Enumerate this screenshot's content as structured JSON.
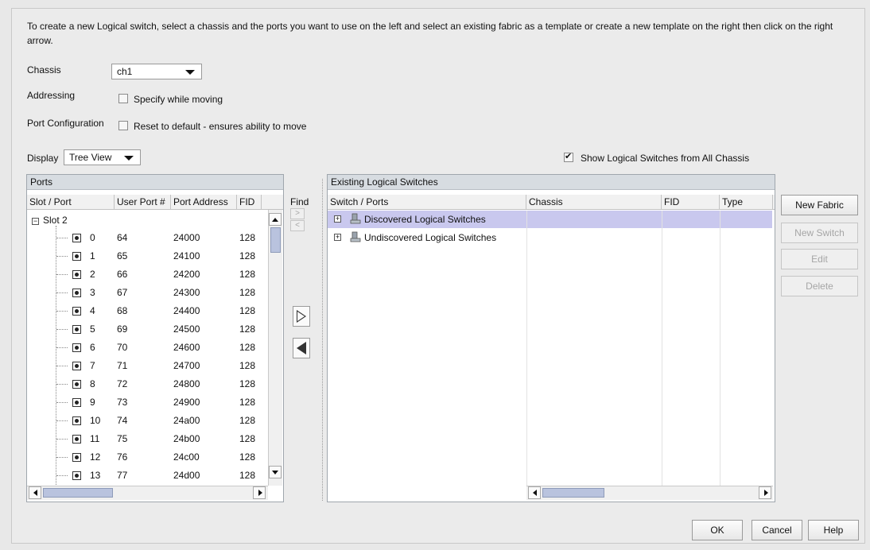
{
  "intro_text": "To create a new Logical switch, select a chassis and the ports you want to use on the left and select an existing fabric as a template or create a new template on the right then click on the right arrow.",
  "chassis": {
    "label": "Chassis",
    "value": "ch1"
  },
  "addressing": {
    "label": "Addressing",
    "checkbox_label": "Specify while moving",
    "checked": false
  },
  "port_config": {
    "label": "Port Configuration",
    "checkbox_label": "Reset to default - ensures ability to move",
    "checked": false
  },
  "display": {
    "label": "Display",
    "value": "Tree View"
  },
  "show_all_chassis": {
    "label": "Show Logical Switches from All Chassis",
    "checked": true
  },
  "ports_panel": {
    "title": "Ports",
    "columns": [
      "Slot / Port",
      "User Port #",
      "Port Address",
      "FID"
    ],
    "slot_label": "Slot 2",
    "rows": [
      {
        "port": "0",
        "user_port": "64",
        "address": "24000",
        "fid": "128"
      },
      {
        "port": "1",
        "user_port": "65",
        "address": "24100",
        "fid": "128"
      },
      {
        "port": "2",
        "user_port": "66",
        "address": "24200",
        "fid": "128"
      },
      {
        "port": "3",
        "user_port": "67",
        "address": "24300",
        "fid": "128"
      },
      {
        "port": "4",
        "user_port": "68",
        "address": "24400",
        "fid": "128"
      },
      {
        "port": "5",
        "user_port": "69",
        "address": "24500",
        "fid": "128"
      },
      {
        "port": "6",
        "user_port": "70",
        "address": "24600",
        "fid": "128"
      },
      {
        "port": "7",
        "user_port": "71",
        "address": "24700",
        "fid": "128"
      },
      {
        "port": "8",
        "user_port": "72",
        "address": "24800",
        "fid": "128"
      },
      {
        "port": "9",
        "user_port": "73",
        "address": "24900",
        "fid": "128"
      },
      {
        "port": "10",
        "user_port": "74",
        "address": "24a00",
        "fid": "128"
      },
      {
        "port": "11",
        "user_port": "75",
        "address": "24b00",
        "fid": "128"
      },
      {
        "port": "12",
        "user_port": "76",
        "address": "24c00",
        "fid": "128"
      },
      {
        "port": "13",
        "user_port": "77",
        "address": "24d00",
        "fid": "128"
      }
    ]
  },
  "find": {
    "label": "Find",
    "next": ">",
    "prev": "<"
  },
  "switches_panel": {
    "title": "Existing Logical Switches",
    "columns": [
      "Switch / Ports",
      "Chassis",
      "FID",
      "Type"
    ],
    "rows": [
      {
        "name": "Discovered Logical Switches",
        "selected": true
      },
      {
        "name": "Undiscovered Logical Switches",
        "selected": false
      }
    ]
  },
  "side_buttons": {
    "new_fabric": "New Fabric",
    "new_switch": "New Switch",
    "edit": "Edit",
    "delete": "Delete"
  },
  "footer": {
    "ok": "OK",
    "cancel": "Cancel",
    "help": "Help"
  },
  "colors": {
    "selection": "#c9c8ee",
    "panel_header": "#d7dce1",
    "scroll_thumb": "#b9c3de"
  }
}
